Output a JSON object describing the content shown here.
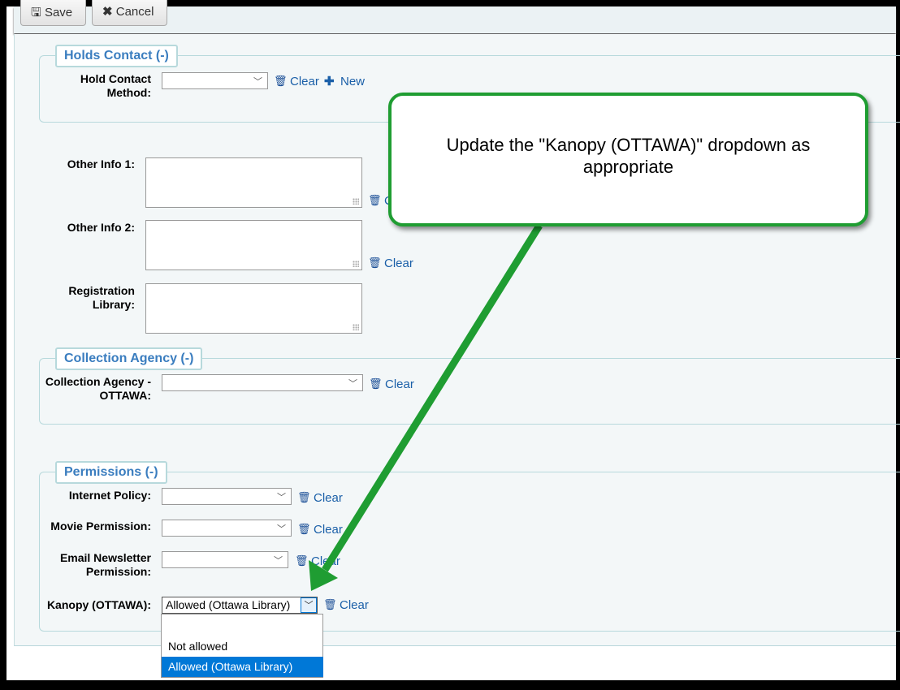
{
  "toolbar": {
    "save": "Save",
    "cancel": "Cancel"
  },
  "holds": {
    "legend": "Holds Contact (-)",
    "label": "Hold Contact Method:",
    "clear": "Clear",
    "new": "New"
  },
  "other": {
    "info1": "Other Info 1:",
    "info2": "Other Info 2:",
    "reg": "Registration Library:",
    "clear": "Clear"
  },
  "collection": {
    "legend": "Collection Agency (-)",
    "label": "Collection Agency - OTTAWA:",
    "clear": "Clear"
  },
  "permissions": {
    "legend": "Permissions (-)",
    "internet": "Internet Policy:",
    "movie": "Movie Permission:",
    "email": "Email Newsletter Permission:",
    "kanopy": "Kanopy (OTTAWA):",
    "clear": "Clear",
    "kanopy_value": "Allowed (Ottawa Library)",
    "options": [
      "",
      "Not allowed",
      "Allowed (Ottawa Library)"
    ]
  },
  "callout": {
    "text": "Update the \"Kanopy (OTTAWA)\" dropdown as appropriate"
  },
  "colors": {
    "callout_border": "#1f9d32",
    "link": "#1a5fa8",
    "selected_option": "#0078d7"
  }
}
